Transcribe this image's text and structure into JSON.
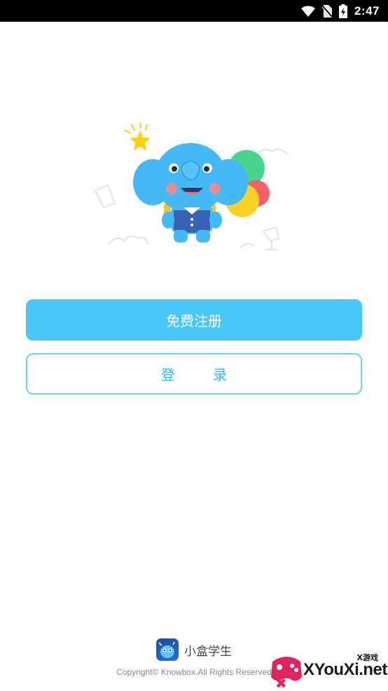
{
  "status_bar": {
    "time": "2:47",
    "icons": [
      "wifi-icon",
      "no-sim-icon",
      "battery-charging-icon"
    ]
  },
  "hero": {
    "illustration": "elephant-mascot-with-balloons",
    "colors": {
      "mascot": "#45b9f5",
      "balloon_green": "#47d58e",
      "balloon_red": "#f2616c",
      "balloon_yellow": "#fcd126",
      "star": "#fdd010"
    }
  },
  "actions": {
    "register_label": "免费注册",
    "login_label": "登 录"
  },
  "footer": {
    "app_name": "小盒学生",
    "copyright": "Copyright© Knowbox.All Rights Reserved"
  },
  "watermark": {
    "small": "X游戏",
    "main": "XYouXi.net"
  },
  "theme": {
    "primary": "#47c8f9",
    "outline": "#6fd0f5",
    "login_text": "#33b9ee"
  }
}
